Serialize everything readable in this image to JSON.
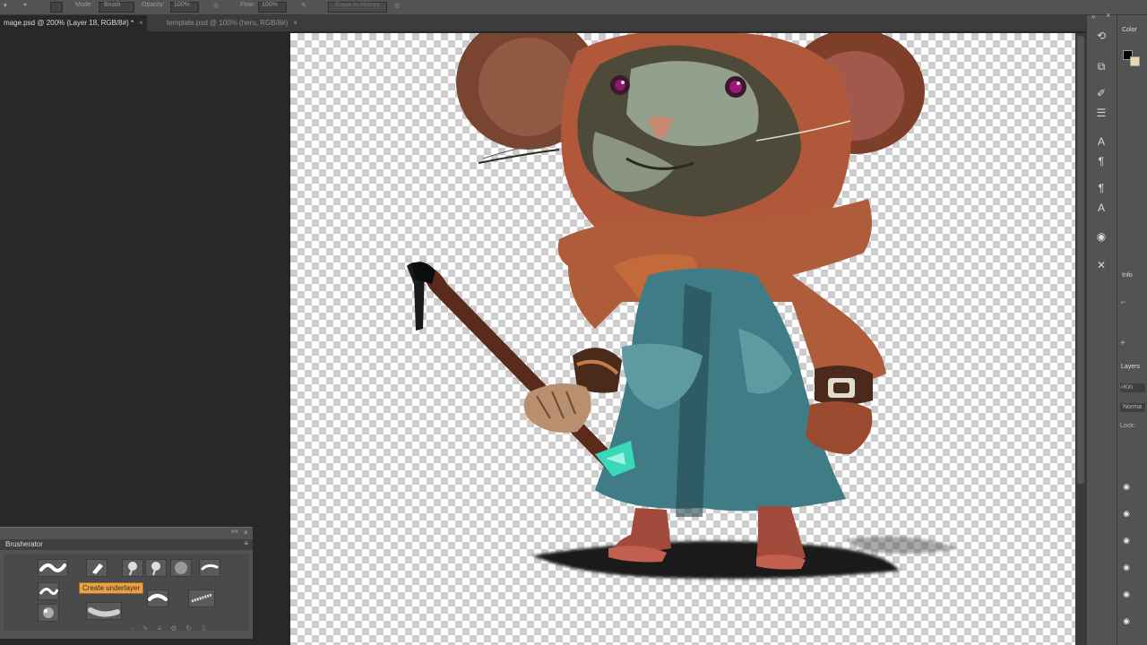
{
  "options_bar": {
    "mode_label": "Mode:",
    "mode_value": "Brush",
    "opacity_label": "Opacity:",
    "opacity_value": "100%",
    "flow_label": "Flow:",
    "flow_value": "100%",
    "erase_history": "Erase to History"
  },
  "tabs": [
    {
      "label": "mage.psd @ 200% (Layer 18, RGB/8#) *",
      "close": "×"
    },
    {
      "label": "template.psd @ 100% (hero, RGB/8#)",
      "close": "×"
    }
  ],
  "right_panels": {
    "color_label": "Color",
    "info_label": "Info",
    "layers_label": "Layers",
    "kind_label": "Kin",
    "blend_mode": "Norma",
    "lock_label": "Lock:"
  },
  "brusherator": {
    "title": "Brusherator",
    "tooltip": "Create underlayer"
  },
  "icons": {
    "tool_strip": [
      "history-brush-icon",
      "clone-source-icon",
      "brush-presets-icon",
      "adjustments-icon",
      "character-icon",
      "paragraph-icon",
      "paragraph-styles-icon",
      "character-styles-icon",
      "visibility-icon",
      "tools-icon"
    ],
    "layer_eyes": 6
  }
}
